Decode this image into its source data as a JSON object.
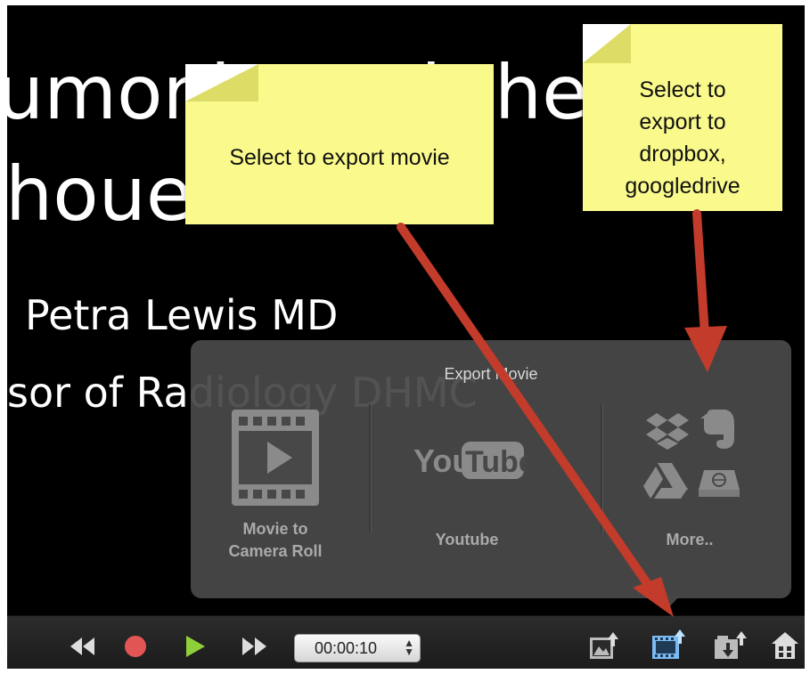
{
  "slide": {
    "line1": "umonia and the",
    "line2": "houe",
    "line3": "Petra Lewis MD",
    "line4": "sor of Radiology DHMC"
  },
  "export_popover": {
    "title": "Export Movie",
    "options": [
      {
        "label": "Movie to Camera Roll",
        "icon": "film-play-icon"
      },
      {
        "label": "Youtube",
        "icon": "youtube-logo"
      },
      {
        "label": "More..",
        "icons": [
          "dropbox-icon",
          "evernote-icon",
          "google-drive-icon",
          "network-drive-icon"
        ]
      }
    ]
  },
  "youtube_logo": {
    "left": "You",
    "right": "Tube"
  },
  "toolbar": {
    "rewind_icon": "rewind-icon",
    "record_icon": "record-icon",
    "play_icon": "play-icon",
    "fast_forward_icon": "fast-forward-icon",
    "time": "00:00:10",
    "share_image_icon": "export-image-icon",
    "export_movie_icon": "export-movie-icon",
    "import_export_icon": "import-export-icon",
    "home_icon": "home-icon"
  },
  "annotations": {
    "note1": "Select to export movie",
    "note2_lines": [
      "Select to",
      "export to",
      "dropbox,",
      "googledrive"
    ]
  },
  "colors": {
    "note": "#fafa8c",
    "arrow": "#c33b2a",
    "record": "#e25555",
    "play": "#8fcf3a",
    "export_highlight": "#7fc4ff"
  }
}
